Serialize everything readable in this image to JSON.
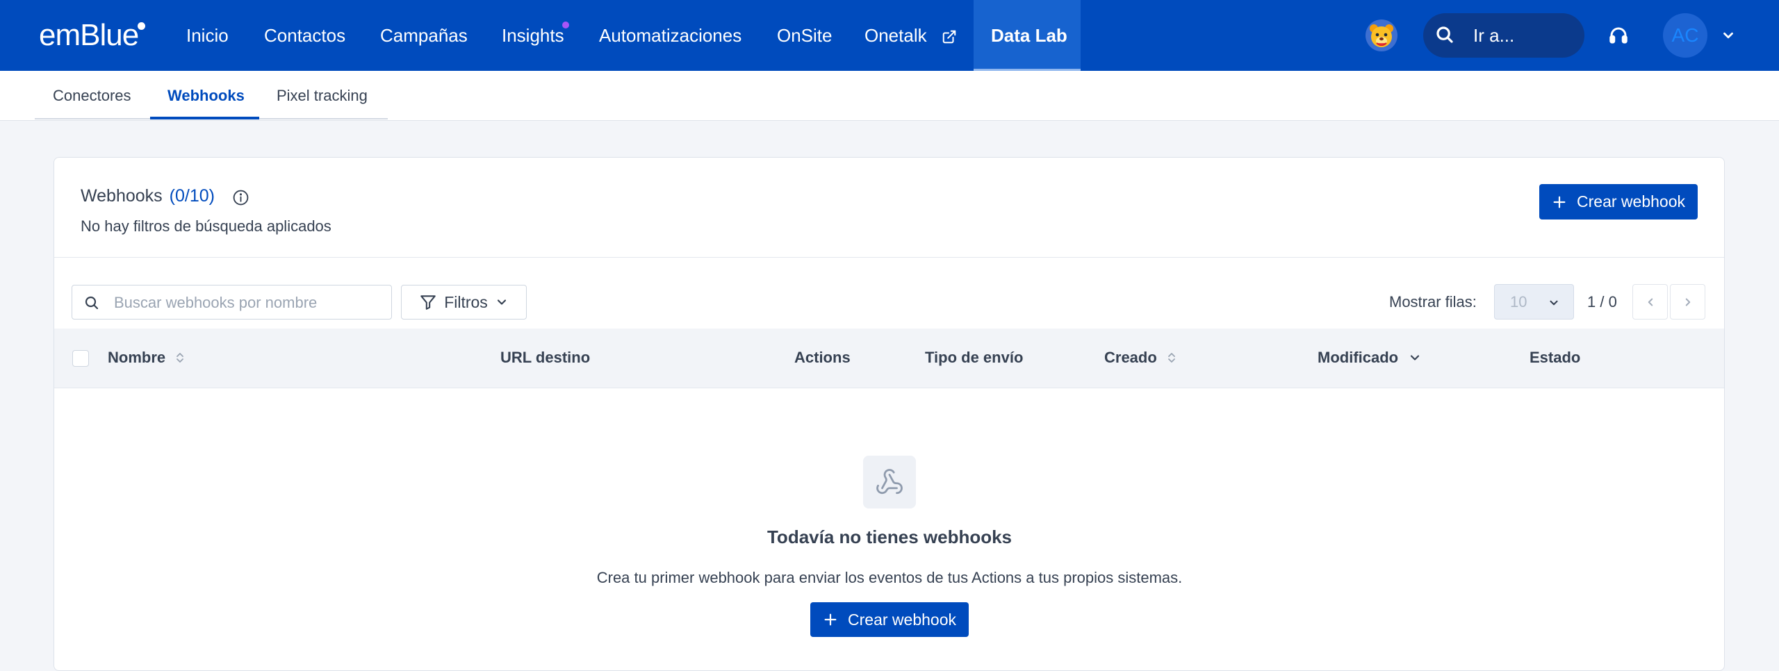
{
  "topnav": {
    "logo": "emBlue",
    "items": [
      "Inicio",
      "Contactos",
      "Campañas",
      "Insights",
      "Automatizaciones",
      "OnSite",
      "Onetalk"
    ],
    "active_item": "Data Lab",
    "search_label": "Ir a...",
    "user_initials": "AC",
    "colors": {
      "bar": "#004bbd",
      "active": "#1763cf",
      "badge": "#a855f7"
    }
  },
  "subtabs": {
    "items": [
      "Conectores",
      "Webhooks",
      "Pixel tracking"
    ],
    "active": "Webhooks"
  },
  "card": {
    "title": "Webhooks",
    "count": "(0/10)",
    "subtitle": "No hay filtros de búsqueda aplicados",
    "create_button": "Crear webhook"
  },
  "toolbar": {
    "search_placeholder": "Buscar webhooks por nombre",
    "filters_label": "Filtros",
    "rows_label": "Mostrar filas:",
    "rows_value": "10",
    "page_info": "1 / 0"
  },
  "table": {
    "columns": [
      "Nombre",
      "URL destino",
      "Actions",
      "Tipo de envío",
      "Creado",
      "Modificado",
      "Estado"
    ]
  },
  "empty_state": {
    "title": "Todavía no tienes webhooks",
    "description": "Crea tu primer webhook para enviar los eventos de tus Actions a tus propios sistemas.",
    "button": "Crear webhook",
    "icon": "webhook-icon"
  }
}
